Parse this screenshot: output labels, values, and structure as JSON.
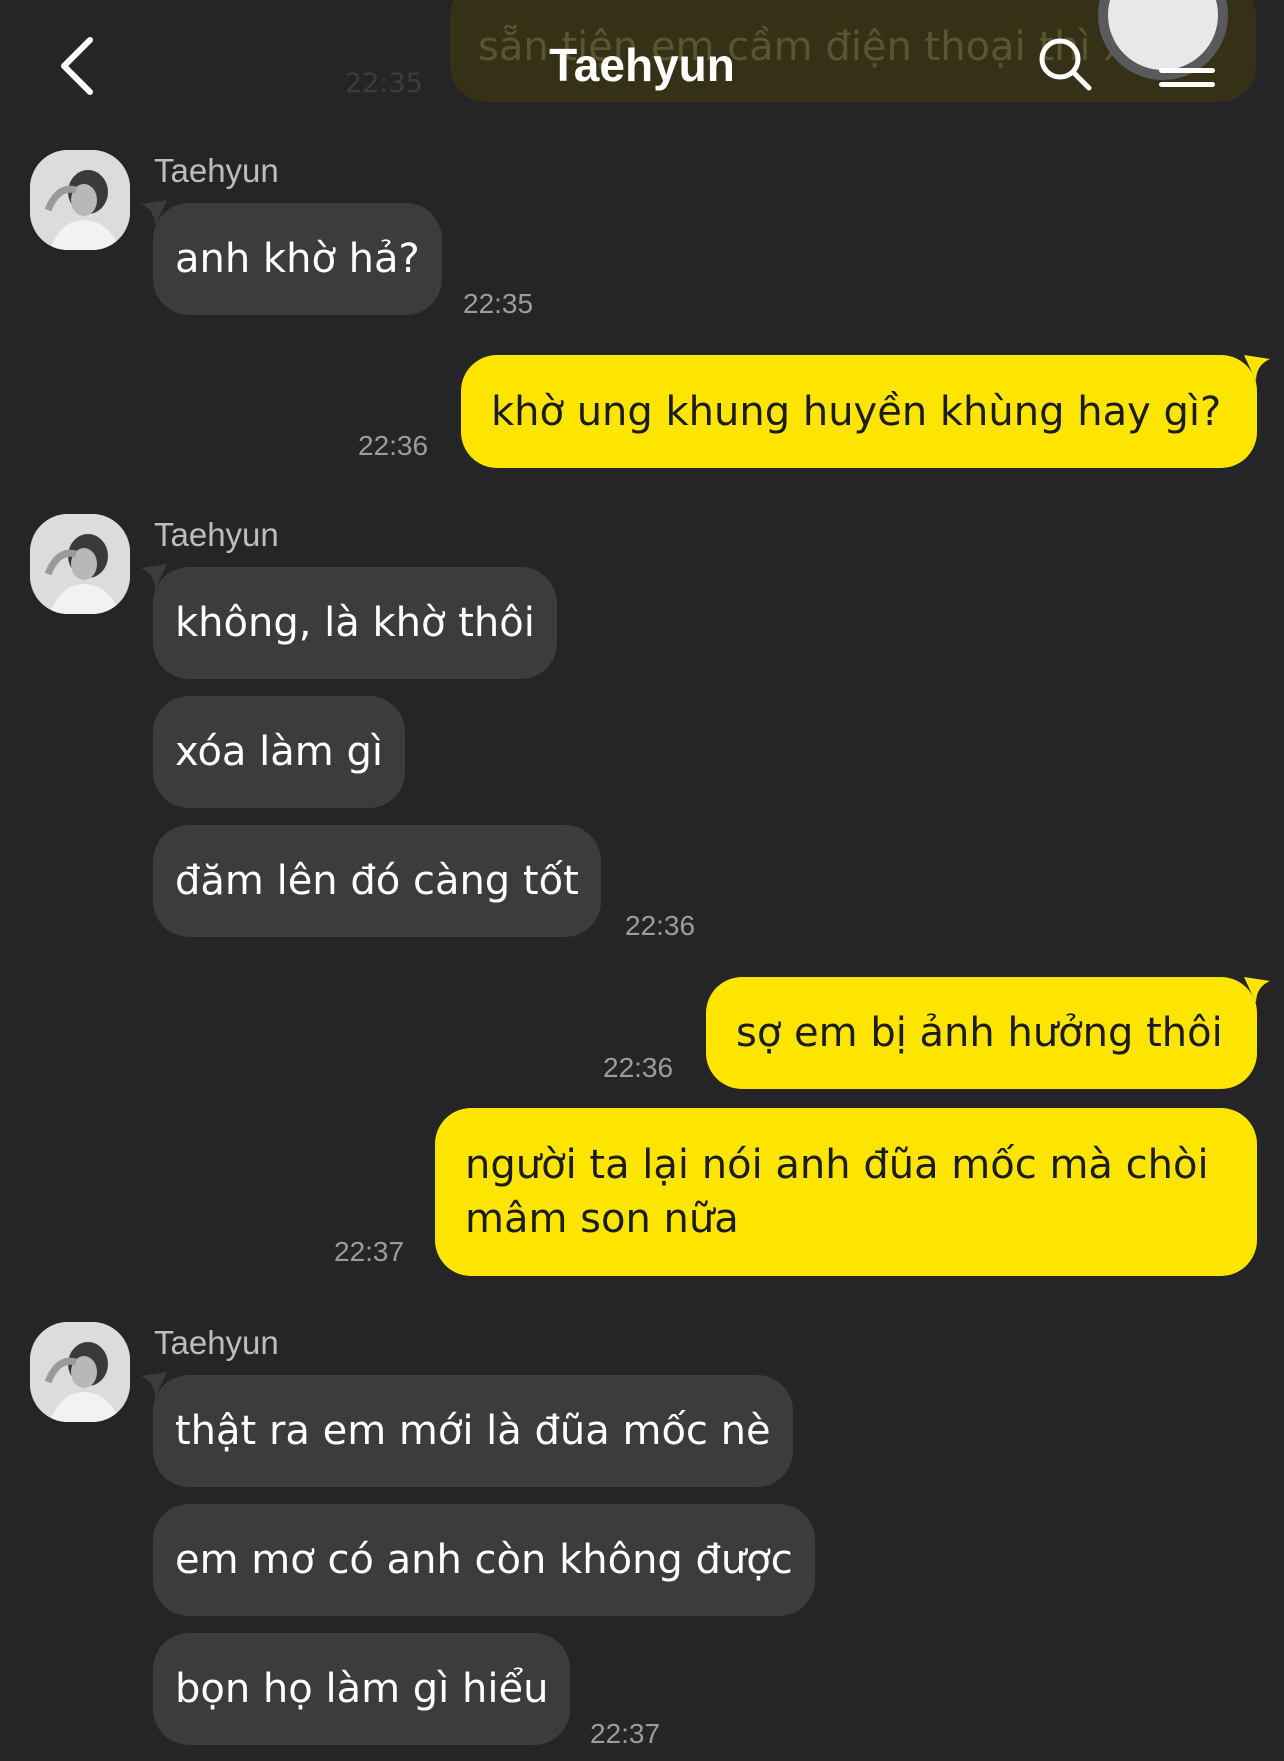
{
  "header": {
    "title": "Taehyun"
  },
  "peek": {
    "text": "sẵn tiện em cầm điện thoại thì x",
    "time": "22:35"
  },
  "groups": [
    {
      "sender": "Taehyun",
      "messages": [
        "anh khờ hả?"
      ],
      "time": "22:35"
    },
    {
      "mine": true,
      "messages": [
        "khờ ung khung huyền khùng hay gì?"
      ],
      "time": "22:36"
    },
    {
      "sender": "Taehyun",
      "messages": [
        "không, là khờ thôi",
        "xóa làm gì",
        "đăm lên đó càng tốt"
      ],
      "time": "22:36"
    },
    {
      "mine": true,
      "messages": [
        "sợ em bị ảnh hưởng thôi"
      ],
      "time": "22:36"
    },
    {
      "mine": true,
      "messages": [
        "người ta lại nói anh đũa mốc mà chòi mâm son nữa"
      ],
      "time": "22:37"
    },
    {
      "sender": "Taehyun",
      "messages": [
        "thật ra em mới là đũa mốc nè",
        "em mơ có anh còn không được",
        "bọn họ làm gì hiểu"
      ],
      "time": "22:37"
    }
  ]
}
